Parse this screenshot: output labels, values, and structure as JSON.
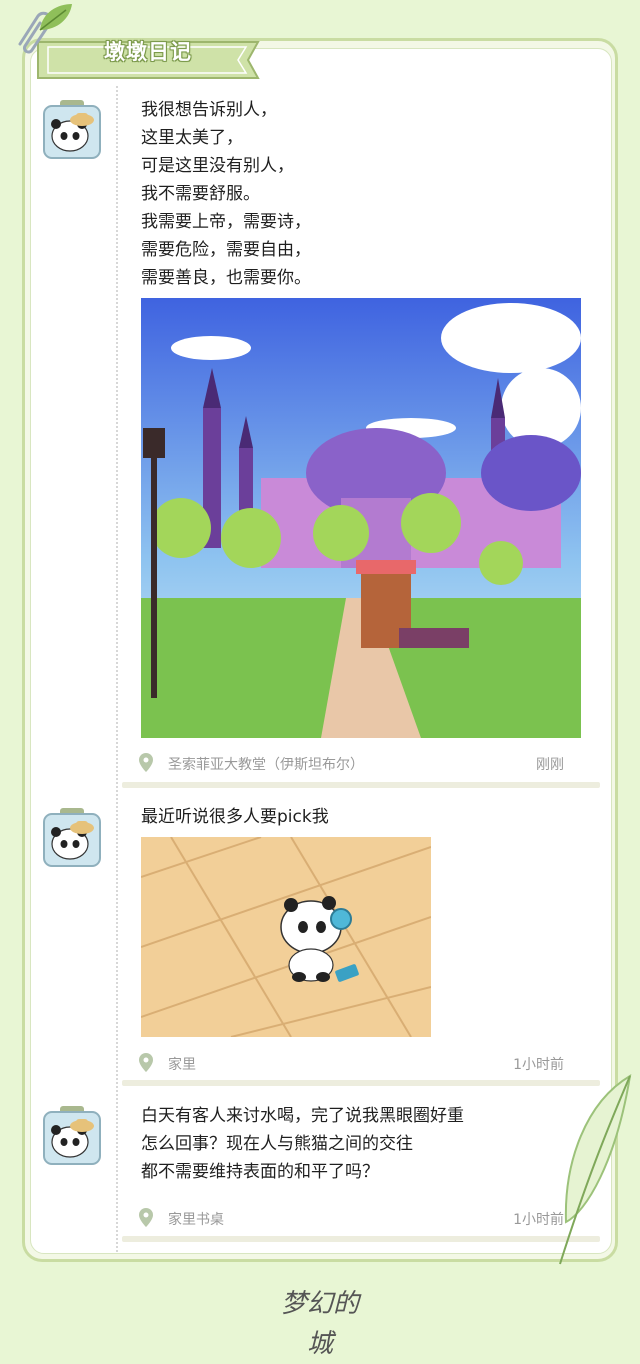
{
  "header": {
    "title": "墩墩日记"
  },
  "posts": [
    {
      "text": "我很想告诉别人，\n这里太美了，\n可是这里没有别人，\n我不需要舒服。\n我需要上帝，需要诗，\n需要危险，需要自由，\n需要善良，也需要你。",
      "location": "圣索菲亚大教堂（伊斯坦布尔）",
      "time": "刚刚"
    },
    {
      "text": "最近听说很多人要pick我",
      "location": "家里",
      "time": "1小时前"
    },
    {
      "text": "白天有客人来讨水喝，完了说我黑眼圈好重\n怎么回事？现在人与熊猫之间的交往\n都不需要维持表面的和平了吗？",
      "location": "家里书桌",
      "time": "1小时前"
    }
  ],
  "footer": {
    "logo_text": "梦幻的城"
  },
  "colors": {
    "background": "#e8f6d4",
    "frame": "#c9dca2",
    "banner": "#cfe2a8"
  }
}
